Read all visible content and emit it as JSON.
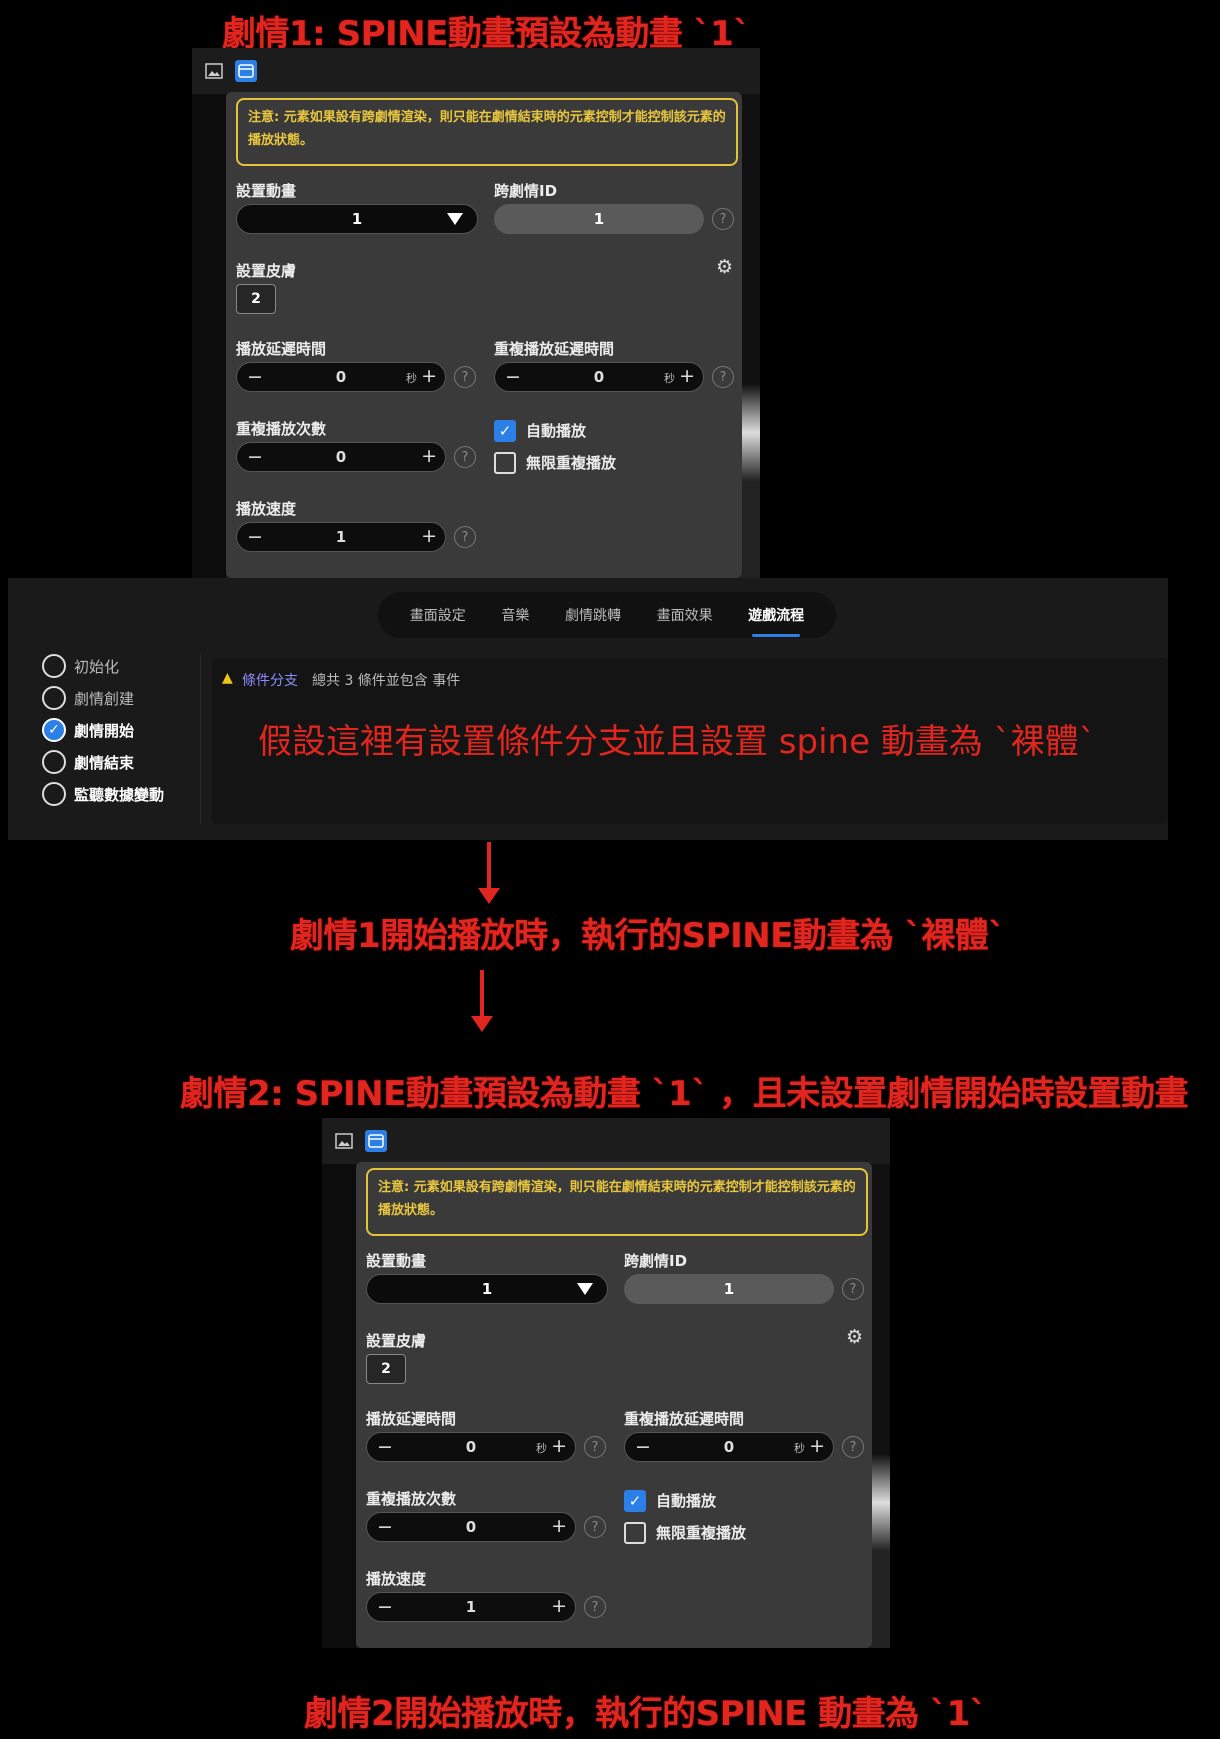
{
  "captions": {
    "c1": "劇情1: SPINE動畫預設為動畫 `1`",
    "c2": "劇情1開始播放時，執行的SPINE動畫為 `裸體`",
    "c3": "劇情2: SPINE動畫預設為動畫 `1` ，且未設置劇情開始時設置動畫",
    "c4": "劇情2開始播放時，執行的SPINE 動畫為 `1`"
  },
  "panel": {
    "notice": "注意: 元素如果設有跨劇情渲染，則只能在劇情結束時的元素控制才能控制該元素的播放狀態。",
    "set_animation_label": "設置動畫",
    "set_animation_value": "1",
    "cross_id_label": "跨劇情ID",
    "cross_id_value": "1",
    "help": "?",
    "skin_label": "設置皮膚",
    "skin_value": "2",
    "delay_label": "播放延遲時間",
    "delay_value": "0",
    "unit": "秒",
    "repeat_delay_label": "重複播放延遲時間",
    "repeat_delay_value": "0",
    "repeat_count_label": "重複播放次數",
    "repeat_count_value": "0",
    "autoplay_label": "自動播放",
    "autoplay_checked": true,
    "loop_label": "無限重複播放",
    "loop_checked": false,
    "speed_label": "播放速度",
    "speed_value": "1",
    "minus": "−",
    "plus": "+"
  },
  "mid": {
    "tabs": [
      "畫面設定",
      "音樂",
      "劇情跳轉",
      "畫面效果",
      "遊戲流程"
    ],
    "active_tab": 4,
    "radios": [
      {
        "label": "初始化",
        "checked": false
      },
      {
        "label": "劇情創建",
        "checked": false
      },
      {
        "label": "劇情開始",
        "checked": true
      },
      {
        "label": "劇情結束",
        "checked": false
      },
      {
        "label": "監聽數據變動",
        "checked": false
      }
    ],
    "branch_label": "條件分支",
    "branch_summary": "總共 3 條件並包含 事件",
    "overlay_text": "假設這裡有設置條件分支並且設置 spine 動畫為 `裸體`"
  }
}
